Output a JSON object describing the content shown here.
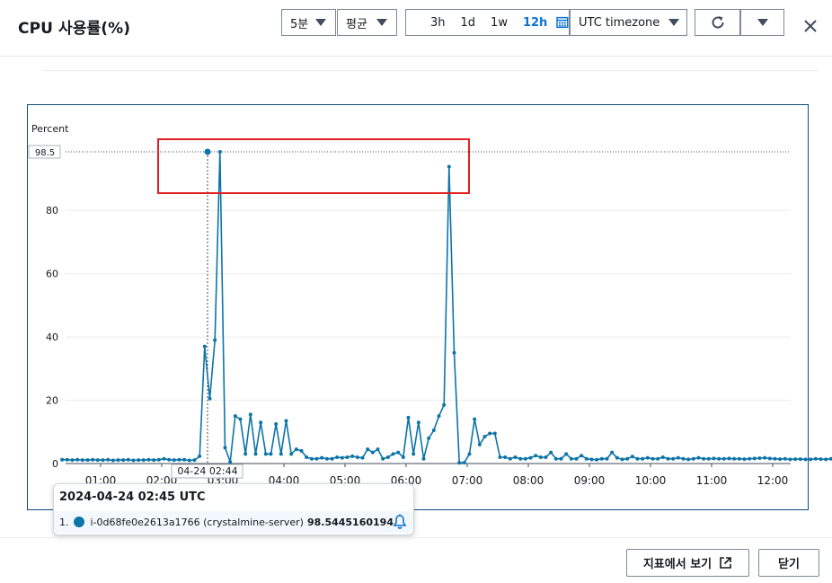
{
  "header": {
    "title": "CPU 사용률(%)",
    "period": "5분",
    "statistic": "평균",
    "ranges": [
      "3h",
      "1d",
      "1w",
      "12h"
    ],
    "active_range": "12h",
    "timezone": "UTC timezone"
  },
  "chart_data": {
    "type": "line",
    "ylabel": "Percent",
    "ylim": [
      0,
      98.5
    ],
    "yticks": [
      0,
      20,
      40,
      60,
      80
    ],
    "max_label": "98.5",
    "xticks": [
      "01:00",
      "02:00",
      "03:00",
      "04:00",
      "05:00",
      "06:00",
      "07:00",
      "08:00",
      "09:00",
      "10:00",
      "11:00",
      "12:00"
    ],
    "x_start_hour": 0.37,
    "x_step_min": 5,
    "series": [
      {
        "name": "i-0d68fe0e2613a1766 (crystalmine-server)",
        "color": "#0d74a8",
        "values": [
          1.2,
          1.2,
          1.1,
          1.2,
          1.1,
          1.1,
          1.2,
          1.1,
          1.1,
          1.2,
          1.0,
          1.1,
          1.1,
          1.2,
          1.0,
          1.1,
          1.1,
          1.2,
          1.1,
          1.2,
          1.5,
          1.2,
          1.1,
          1.2,
          1.2,
          1.0,
          1.1,
          2.3,
          37,
          20.5,
          39,
          98.5,
          5,
          0.5,
          15,
          14,
          3,
          15.5,
          3,
          13,
          3,
          3,
          12.5,
          3,
          13.5,
          3,
          4.5,
          4,
          2,
          1.5,
          1.5,
          1.8,
          1.5,
          1.5,
          2,
          1.8,
          2,
          2.3,
          2,
          1.8,
          4.5,
          3.5,
          4.5,
          1.5,
          2,
          3,
          3.5,
          2,
          14.5,
          3,
          13,
          1.5,
          8,
          10.5,
          15,
          18.5,
          93.8,
          35,
          0.2,
          0.3,
          3,
          14,
          6,
          8.5,
          9.5,
          9.5,
          2,
          2,
          1.5,
          2,
          1.5,
          1.5,
          1.8,
          2.5,
          2,
          2,
          3.5,
          1.5,
          1.5,
          3,
          1.5,
          1.5,
          2.5,
          1.5,
          1.3,
          1.2,
          1.5,
          1.5,
          3.5,
          1.8,
          1.3,
          1.5,
          2.2,
          1.5,
          1.5,
          1.8,
          1.5,
          1.5,
          2,
          1.5,
          1.5,
          1.8,
          1.5,
          1.3,
          1.5,
          1.8,
          1.5,
          1.5,
          1.6,
          1.5,
          1.5,
          1.6,
          1.5,
          1.5,
          1.4,
          1.5,
          1.6,
          1.7,
          1.8,
          1.6,
          1.5,
          1.4,
          1.5,
          1.3,
          1.4,
          1.4,
          1.3,
          1.3,
          1.5,
          1.4,
          1.3,
          1.5,
          1.4,
          1.2,
          1.6,
          1.5,
          1.3,
          1.4,
          1.4,
          1.3,
          1.2,
          1.5,
          1.4,
          1.3,
          1.5,
          1.8
        ]
      }
    ]
  },
  "cursor_label": "04-24 02:44",
  "tooltip": {
    "title": "2024-04-24 02:45 UTC",
    "index": "1.",
    "series_name": "i-0d68fe0e2613a1766 (crystalmine-server)",
    "value": "98.5445160194"
  },
  "footer": {
    "view_in_metrics": "지표에서 보기",
    "close": "닫기"
  }
}
